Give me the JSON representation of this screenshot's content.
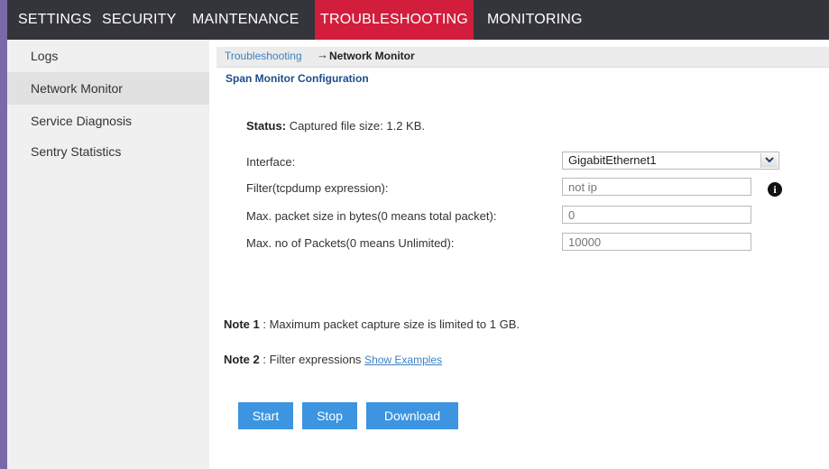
{
  "topnav": {
    "tabs": [
      "SETTINGS",
      "SECURITY",
      "MAINTENANCE",
      "TROUBLESHOOTING",
      "MONITORING"
    ],
    "active": "TROUBLESHOOTING",
    "active_color": "#d21d3c"
  },
  "sidebar": {
    "items": [
      "Logs",
      "Network Monitor",
      "Service Diagnosis",
      "Sentry Statistics"
    ],
    "active": "Network Monitor"
  },
  "breadcrumb": {
    "parent": "Troubleshooting",
    "arrow": "→",
    "current": "Network Monitor"
  },
  "section_title": "Span Monitor Configuration",
  "status": {
    "label": "Status:",
    "text": "Captured file size: 1.2 KB."
  },
  "form": {
    "interface": {
      "label": "Interface:",
      "value": "GigabitEthernet1"
    },
    "filter": {
      "label": "Filter(tcpdump expression):",
      "placeholder": "not ip"
    },
    "max_size": {
      "label": "Max. packet size in bytes(0 means total packet):",
      "placeholder": "0"
    },
    "max_packets": {
      "label": "Max. no of Packets(0 means Unlimited):",
      "placeholder": "10000"
    }
  },
  "notes": {
    "note1_label": "Note 1",
    "note1_text": " : Maximum packet capture size is limited to 1 GB.",
    "note2_label": "Note 2",
    "note2_text": " : Filter expressions ",
    "note2_link": "Show Examples"
  },
  "buttons": {
    "start": "Start",
    "stop": "Stop",
    "download": "Download",
    "color": "#3d94e0"
  },
  "icons": {
    "info": "info-icon",
    "dropdown": "chevron-down-icon"
  }
}
